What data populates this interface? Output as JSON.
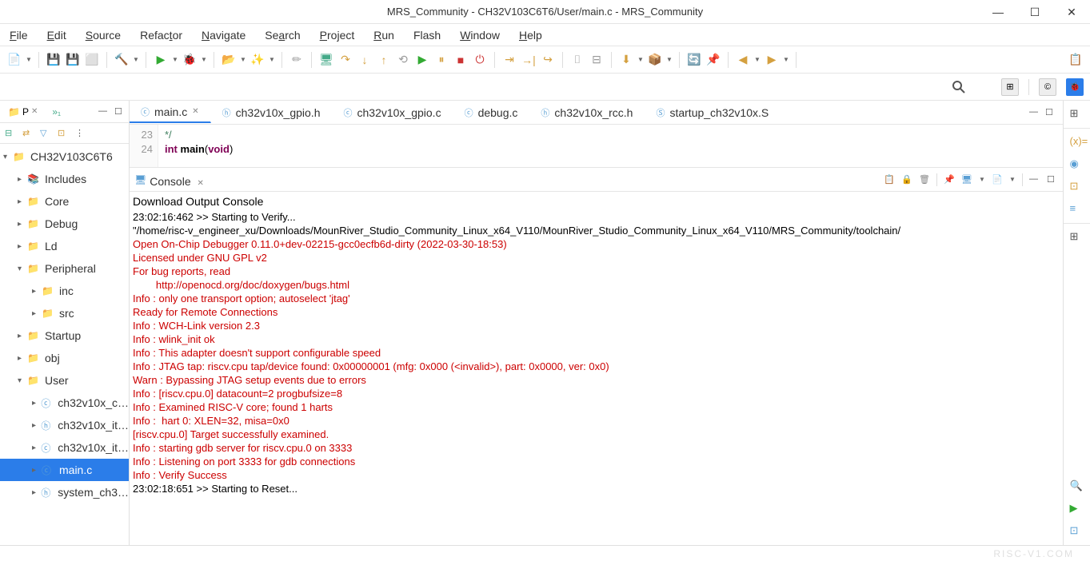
{
  "window": {
    "title": "MRS_Community - CH32V103C6T6/User/main.c - MRS_Community"
  },
  "menubar": {
    "items": [
      "File",
      "Edit",
      "Source",
      "Refactor",
      "Navigate",
      "Search",
      "Project",
      "Run",
      "Flash",
      "Window",
      "Help"
    ]
  },
  "project_explorer": {
    "tab_label": "P",
    "root": "CH32V103C6T6",
    "nodes": [
      {
        "label": "Includes",
        "type": "inc",
        "depth": 1,
        "expanded": false,
        "arrow": "▸"
      },
      {
        "label": "Core",
        "type": "folder",
        "depth": 1,
        "expanded": false,
        "arrow": "▸"
      },
      {
        "label": "Debug",
        "type": "folder",
        "depth": 1,
        "expanded": false,
        "arrow": "▸"
      },
      {
        "label": "Ld",
        "type": "folder",
        "depth": 1,
        "expanded": false,
        "arrow": "▸"
      },
      {
        "label": "Peripheral",
        "type": "folder",
        "depth": 1,
        "expanded": true,
        "arrow": "▾"
      },
      {
        "label": "inc",
        "type": "folder",
        "depth": 2,
        "expanded": false,
        "arrow": "▸"
      },
      {
        "label": "src",
        "type": "folder",
        "depth": 2,
        "expanded": false,
        "arrow": "▸"
      },
      {
        "label": "Startup",
        "type": "folder",
        "depth": 1,
        "expanded": false,
        "arrow": "▸"
      },
      {
        "label": "obj",
        "type": "folder",
        "depth": 1,
        "expanded": false,
        "arrow": "▸"
      },
      {
        "label": "User",
        "type": "folder",
        "depth": 1,
        "expanded": true,
        "arrow": "▾"
      },
      {
        "label": "ch32v10x_c…",
        "type": "file",
        "depth": 2,
        "arrow": "▸"
      },
      {
        "label": "ch32v10x_it…",
        "type": "h",
        "depth": 2,
        "arrow": "▸"
      },
      {
        "label": "ch32v10x_it…",
        "type": "file",
        "depth": 2,
        "arrow": "▸"
      },
      {
        "label": "main.c",
        "type": "file",
        "depth": 2,
        "arrow": "▸",
        "selected": true
      },
      {
        "label": "system_ch3…",
        "type": "h",
        "depth": 2,
        "arrow": "▸"
      }
    ]
  },
  "editor": {
    "tabs": [
      {
        "label": "main.c",
        "icon": "c",
        "active": true,
        "close": true
      },
      {
        "label": "ch32v10x_gpio.h",
        "icon": "h"
      },
      {
        "label": "ch32v10x_gpio.c",
        "icon": "c"
      },
      {
        "label": "debug.c",
        "icon": "c"
      },
      {
        "label": "ch32v10x_rcc.h",
        "icon": "h"
      },
      {
        "label": "startup_ch32v10x.S",
        "icon": "s"
      }
    ],
    "line_numbers": [
      "23",
      "24"
    ],
    "code": {
      "line23": "*/",
      "line24_kw1": "int",
      "line24_fn": "main",
      "line24_kw2": "void"
    }
  },
  "console": {
    "tab_label": "Console",
    "header": "Download Output Console",
    "lines": [
      {
        "text": "",
        "color": "black"
      },
      {
        "text": "23:02:16:462 >> Starting to Verify...",
        "color": "black"
      },
      {
        "text": "\"/home/risc-v_engineer_xu/Downloads/MounRiver_Studio_Community_Linux_x64_V110/MounRiver_Studio_Community_Linux_x64_V110/MRS_Community/toolchain/",
        "color": "black"
      },
      {
        "text": "Open On-Chip Debugger 0.11.0+dev-02215-gcc0ecfb6d-dirty (2022-03-30-18:53)",
        "color": "red"
      },
      {
        "text": "Licensed under GNU GPL v2",
        "color": "red"
      },
      {
        "text": "For bug reports, read",
        "color": "red"
      },
      {
        "text": "        http://openocd.org/doc/doxygen/bugs.html",
        "color": "red"
      },
      {
        "text": "Info : only one transport option; autoselect 'jtag'",
        "color": "red"
      },
      {
        "text": "Ready for Remote Connections",
        "color": "red"
      },
      {
        "text": "Info : WCH-Link version 2.3",
        "color": "red"
      },
      {
        "text": "Info : wlink_init ok",
        "color": "red"
      },
      {
        "text": "Info : This adapter doesn't support configurable speed",
        "color": "red"
      },
      {
        "text": "Info : JTAG tap: riscv.cpu tap/device found: 0x00000001 (mfg: 0x000 (<invalid>), part: 0x0000, ver: 0x0)",
        "color": "red"
      },
      {
        "text": "Warn : Bypassing JTAG setup events due to errors",
        "color": "red"
      },
      {
        "text": "Info : [riscv.cpu.0] datacount=2 progbufsize=8",
        "color": "red"
      },
      {
        "text": "Info : Examined RISC-V core; found 1 harts",
        "color": "red"
      },
      {
        "text": "Info :  hart 0: XLEN=32, misa=0x0",
        "color": "red"
      },
      {
        "text": "[riscv.cpu.0] Target successfully examined.",
        "color": "red"
      },
      {
        "text": "Info : starting gdb server for riscv.cpu.0 on 3333",
        "color": "red"
      },
      {
        "text": "Info : Listening on port 3333 for gdb connections",
        "color": "red"
      },
      {
        "text": "Info : Verify Success",
        "color": "red"
      },
      {
        "text": "",
        "color": "black"
      },
      {
        "text": "23:02:18:651 >> Starting to Reset...",
        "color": "black"
      }
    ]
  },
  "statusbar": {
    "watermark": "RISC-V1.COM"
  },
  "right_strip": {
    "items_top": [
      "⊞",
      "(x)=",
      "◉",
      "⊡",
      "≡"
    ],
    "items_bottom": [
      "⊞",
      "🔍",
      "▶",
      "⊡"
    ]
  }
}
